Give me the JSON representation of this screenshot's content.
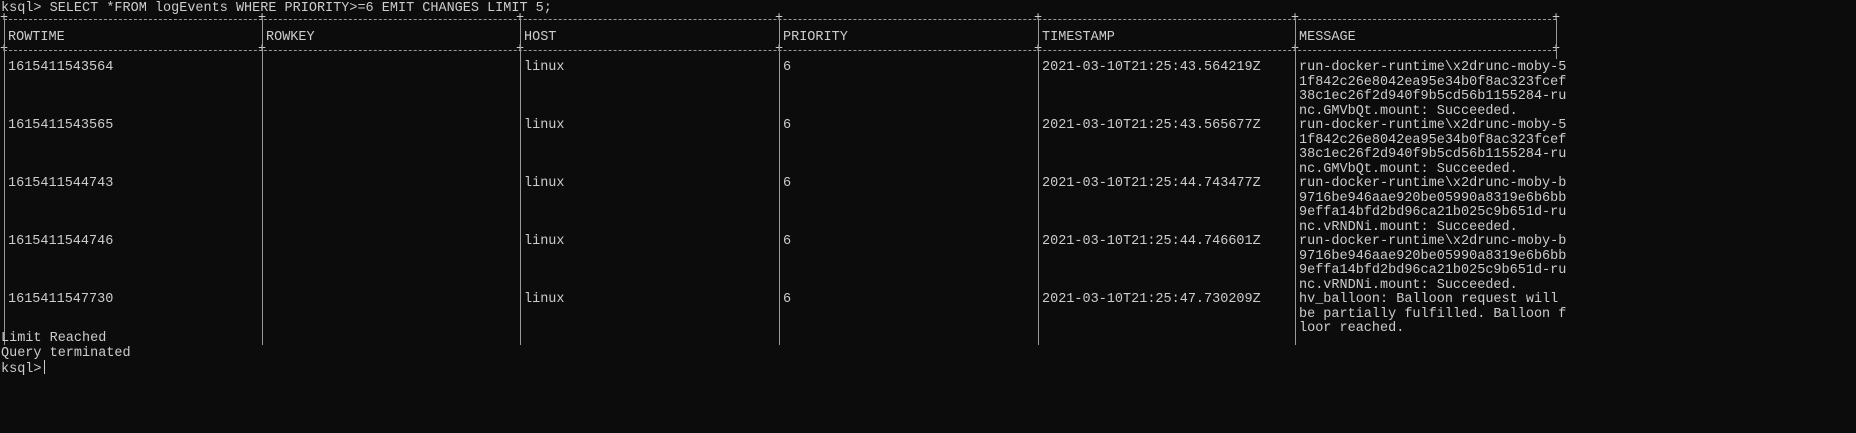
{
  "terminal": {
    "command_line": "ksql> SELECT *FROM logEvents WHERE PRIORITY>=6 EMIT CHANGES LIMIT 5;",
    "columns": [
      "ROWTIME",
      "ROWKEY",
      "HOST",
      "PRIORITY",
      "TIMESTAMP",
      "MESSAGE"
    ],
    "rows": [
      {
        "rowtime": "1615411543564",
        "rowkey": "",
        "host": "linux",
        "priority": "6",
        "timestamp": "2021-03-10T21:25:43.564219Z",
        "message_lines": [
          "run-docker-runtime\\x2drunc-moby-5",
          "1f842c26e8042ea95e34b0f8ac323fcef",
          "38c1ec26f2d940f9b5cd56b1155284-ru",
          "nc.GMVbQt.mount: Succeeded."
        ]
      },
      {
        "rowtime": "1615411543565",
        "rowkey": "",
        "host": "linux",
        "priority": "6",
        "timestamp": "2021-03-10T21:25:43.565677Z",
        "message_lines": [
          "run-docker-runtime\\x2drunc-moby-5",
          "1f842c26e8042ea95e34b0f8ac323fcef",
          "38c1ec26f2d940f9b5cd56b1155284-ru",
          "nc.GMVbQt.mount: Succeeded."
        ]
      },
      {
        "rowtime": "1615411544743",
        "rowkey": "",
        "host": "linux",
        "priority": "6",
        "timestamp": "2021-03-10T21:25:44.743477Z",
        "message_lines": [
          "run-docker-runtime\\x2drunc-moby-b",
          "9716be946aae920be05990a8319e6b6bb",
          "9effa14bfd2bd96ca21b025c9b651d-ru",
          "nc.vRNDNi.mount: Succeeded."
        ]
      },
      {
        "rowtime": "1615411544746",
        "rowkey": "",
        "host": "linux",
        "priority": "6",
        "timestamp": "2021-03-10T21:25:44.746601Z",
        "message_lines": [
          "run-docker-runtime\\x2drunc-moby-b",
          "9716be946aae920be05990a8319e6b6bb",
          "9effa14bfd2bd96ca21b025c9b651d-ru",
          "nc.vRNDNi.mount: Succeeded."
        ]
      },
      {
        "rowtime": "1615411547730",
        "rowkey": "",
        "host": "linux",
        "priority": "6",
        "timestamp": "2021-03-10T21:25:47.730209Z",
        "message_lines": [
          "hv_balloon: Balloon request will ",
          "be partially fulfilled. Balloon f",
          "loor reached."
        ]
      }
    ],
    "footer_limit": "Limit Reached",
    "footer_terminated": "Query terminated",
    "prompt": "ksql>"
  },
  "colors": {
    "background": "#0c0c0c",
    "text": "#cccccc",
    "border": "#9a9a9a"
  }
}
